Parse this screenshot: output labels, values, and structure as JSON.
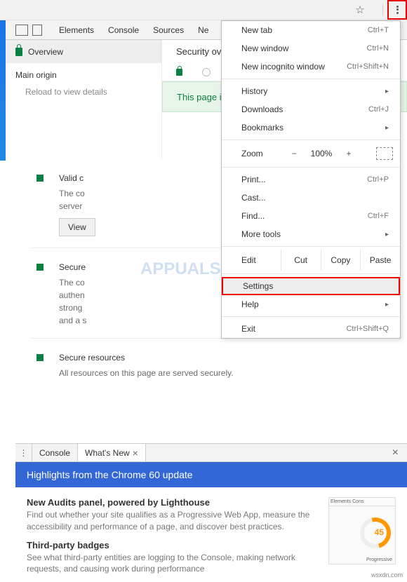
{
  "toolbar": {
    "star": "☆"
  },
  "devtools_tabs": [
    "Elements",
    "Console",
    "Sources",
    "Ne"
  ],
  "overview_label": "Overview",
  "main_origin": "Main origin",
  "reload_hint": "Reload to view details",
  "security_heading": "Security ov",
  "secure_band": "This page i",
  "blocks": [
    {
      "title": "Valid c",
      "desc1": "The co",
      "desc2": "server",
      "btn": "View"
    },
    {
      "title": "Secure",
      "desc1": "The co",
      "desc2": "authen",
      "desc3": "strong",
      "desc4": "and a s"
    },
    {
      "title": "Secure resources",
      "full": "All resources on this page are served securely."
    }
  ],
  "ctx": {
    "new_tab": "New tab",
    "new_tab_sc": "Ctrl+T",
    "new_win": "New window",
    "new_win_sc": "Ctrl+N",
    "incog": "New incognito window",
    "incog_sc": "Ctrl+Shift+N",
    "history": "History",
    "downloads": "Downloads",
    "downloads_sc": "Ctrl+J",
    "bookmarks": "Bookmarks",
    "zoom": "Zoom",
    "zoom_minus": "−",
    "zoom_val": "100%",
    "zoom_plus": "+",
    "print": "Print...",
    "print_sc": "Ctrl+P",
    "cast": "Cast...",
    "find": "Find...",
    "find_sc": "Ctrl+F",
    "more_tools": "More tools",
    "edit": "Edit",
    "cut": "Cut",
    "copy": "Copy",
    "paste": "Paste",
    "settings": "Settings",
    "help": "Help",
    "exit": "Exit",
    "exit_sc": "Ctrl+Shift+Q"
  },
  "drawer": {
    "console": "Console",
    "whatsnew": "What's New",
    "headline": "Highlights from the Chrome 60 update",
    "h1": "New Audits panel, powered by Lighthouse",
    "p1": "Find out whether your site qualifies as a Progressive Web App, measure the accessibility and performance of a page, and discover best practices.",
    "h2": "Third-party badges",
    "p2": "See what third-party entities are logging to the Console, making network requests, and causing work during performance",
    "thumb_gauge": "45",
    "thumb_label": "Progressive"
  },
  "credit": "wsxdn.com"
}
